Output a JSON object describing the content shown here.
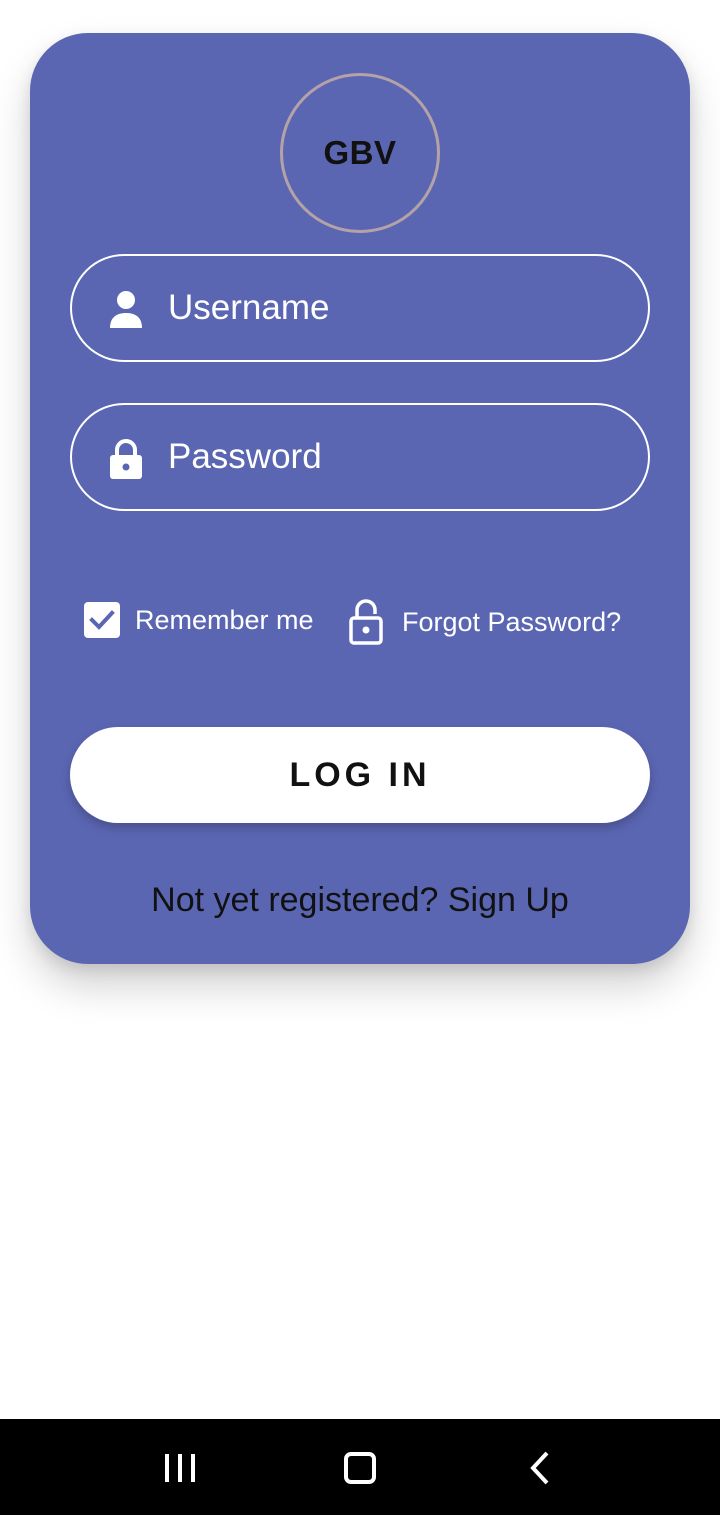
{
  "logo": {
    "text": "GBV"
  },
  "form": {
    "username": {
      "placeholder": "Username",
      "value": ""
    },
    "password": {
      "placeholder": "Password",
      "value": ""
    },
    "remember_label": "Remember me",
    "remember_checked": true,
    "forgot_label": "Forgot Password?",
    "login_label": "LOG IN",
    "signup_prompt": "Not yet registered?",
    "signup_link": "Sign Up"
  },
  "icons": {
    "username": "person-icon",
    "password": "lock-icon",
    "forgot": "lock-outline-icon",
    "checkbox": "check-icon"
  },
  "nav": [
    "recent-apps-icon",
    "home-icon",
    "back-icon"
  ],
  "colors": {
    "card": "#5b66b3",
    "logo_ring": "#b3a2a8",
    "text_light": "#ffffff",
    "text_dark": "#111111",
    "navbar": "#000000"
  }
}
